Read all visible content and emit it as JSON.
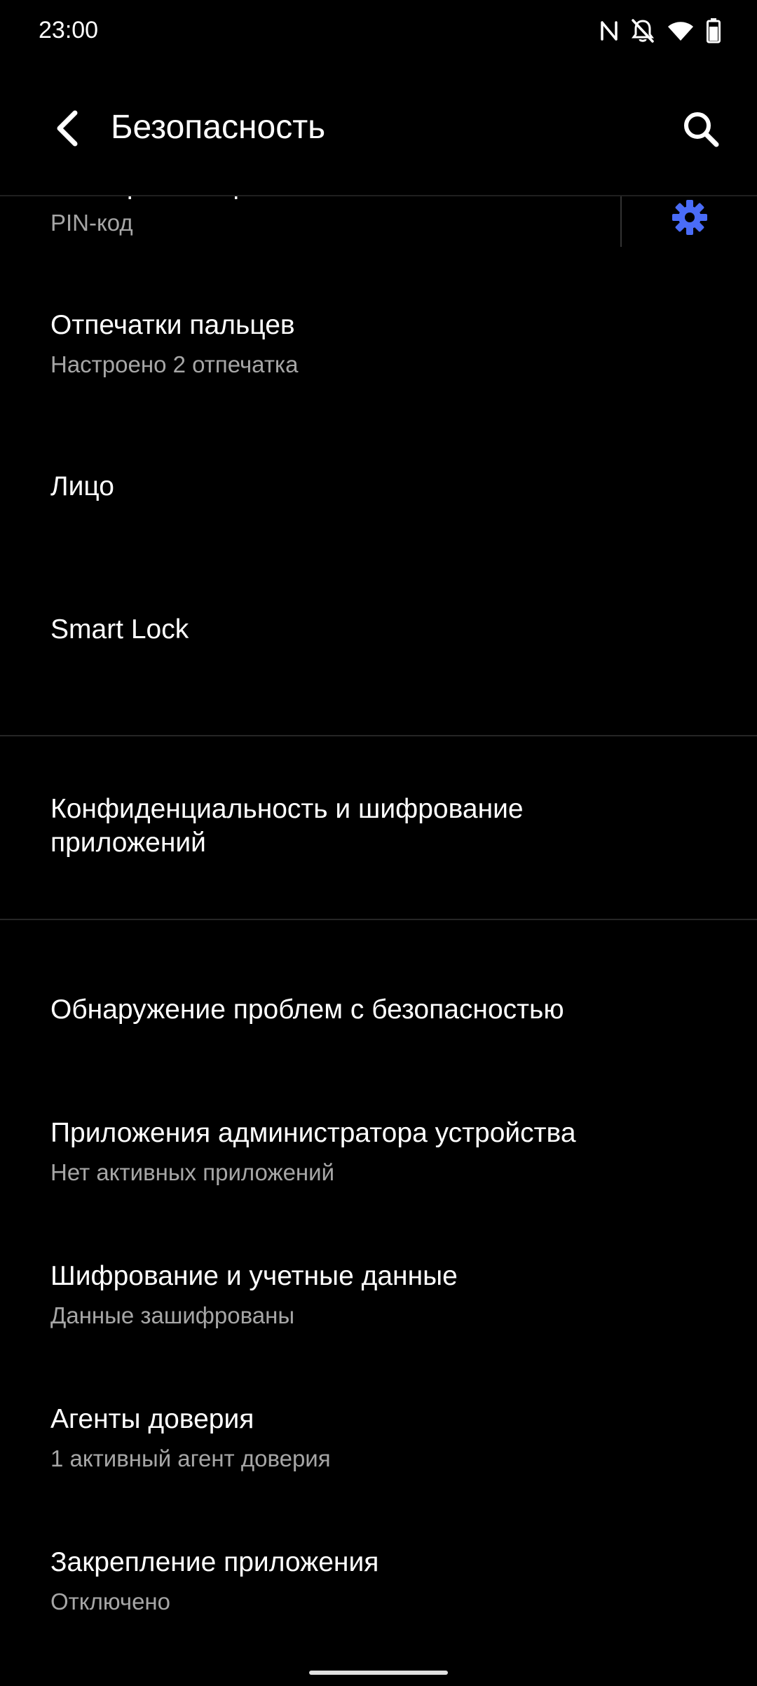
{
  "status_bar": {
    "time": "23:00",
    "icons": [
      "nfc-icon",
      "notifications-off-icon",
      "wifi-icon",
      "battery-icon"
    ]
  },
  "app_bar": {
    "title": "Безопасность",
    "back_icon": "arrow-back-icon",
    "search_icon": "search-icon"
  },
  "colors": {
    "background": "#000000",
    "accent": "#4a6cf7",
    "secondary_text": "#a6a6a6"
  },
  "items": [
    {
      "title": "Блокировка экрана",
      "subtitle": "PIN-код",
      "settings_icon": "gear-icon"
    },
    {
      "title": "Отпечатки пальцев",
      "subtitle": "Настроено 2 отпечатка"
    },
    {
      "title": "Лицо"
    },
    {
      "title": "Smart Lock"
    },
    {
      "title": "Конфиденциальность и шифрование приложений"
    },
    {
      "title": "Обнаружение проблем с безопасностью"
    },
    {
      "title": "Приложения администратора устройства",
      "subtitle": "Нет активных приложений"
    },
    {
      "title": "Шифрование и учетные данные",
      "subtitle": "Данные зашифрованы"
    },
    {
      "title": "Агенты доверия",
      "subtitle": "1 активный агент доверия"
    },
    {
      "title": "Закрепление приложения",
      "subtitle": "Отключено"
    }
  ]
}
